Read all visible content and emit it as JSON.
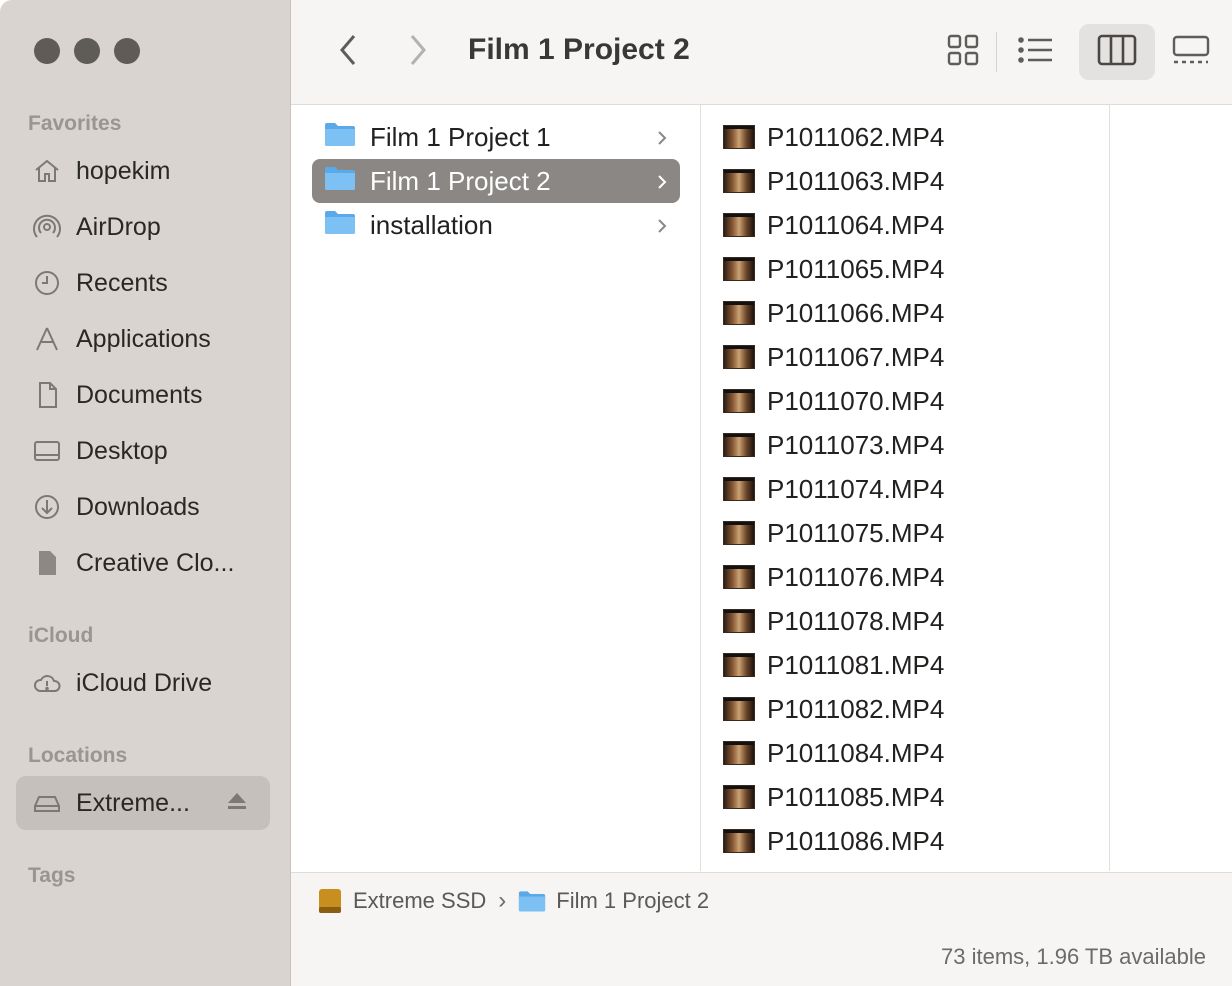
{
  "sidebar": {
    "favorites_title": "Favorites",
    "favorites": [
      {
        "label": "hopekim",
        "icon": "house-icon"
      },
      {
        "label": "AirDrop",
        "icon": "airdrop-icon"
      },
      {
        "label": "Recents",
        "icon": "clock-icon"
      },
      {
        "label": "Applications",
        "icon": "applications-icon"
      },
      {
        "label": "Documents",
        "icon": "document-icon"
      },
      {
        "label": "Desktop",
        "icon": "desktop-icon"
      },
      {
        "label": "Downloads",
        "icon": "download-icon"
      },
      {
        "label": "Creative Clo...",
        "icon": "file-icon"
      }
    ],
    "icloud_title": "iCloud",
    "icloud": [
      {
        "label": "iCloud Drive",
        "icon": "cloud-icon"
      }
    ],
    "locations_title": "Locations",
    "locations": [
      {
        "label": "Extreme...",
        "icon": "drive-icon",
        "selected": true
      }
    ],
    "tags_title": "Tags"
  },
  "toolbar": {
    "title": "Film 1 Project 2",
    "active_view": "columns"
  },
  "column1": {
    "items": [
      {
        "label": "Film 1 Project 1",
        "selected": false
      },
      {
        "label": "Film 1 Project 2",
        "selected": true
      },
      {
        "label": "installation",
        "selected": false
      }
    ]
  },
  "column2": {
    "files": [
      "P1011062.MP4",
      "P1011063.MP4",
      "P1011064.MP4",
      "P1011065.MP4",
      "P1011066.MP4",
      "P1011067.MP4",
      "P1011070.MP4",
      "P1011073.MP4",
      "P1011074.MP4",
      "P1011075.MP4",
      "P1011076.MP4",
      "P1011078.MP4",
      "P1011081.MP4",
      "P1011082.MP4",
      "P1011084.MP4",
      "P1011085.MP4",
      "P1011086.MP4"
    ]
  },
  "pathbar": {
    "drive": "Extreme SSD",
    "separator": "›",
    "folder": "Film 1 Project 2"
  },
  "status": {
    "text": "73 items, 1.96 TB available"
  },
  "colors": {
    "sidebar": "#d9d4cf",
    "selection": "#8a8785",
    "folder_blue": "#5aaaea"
  }
}
